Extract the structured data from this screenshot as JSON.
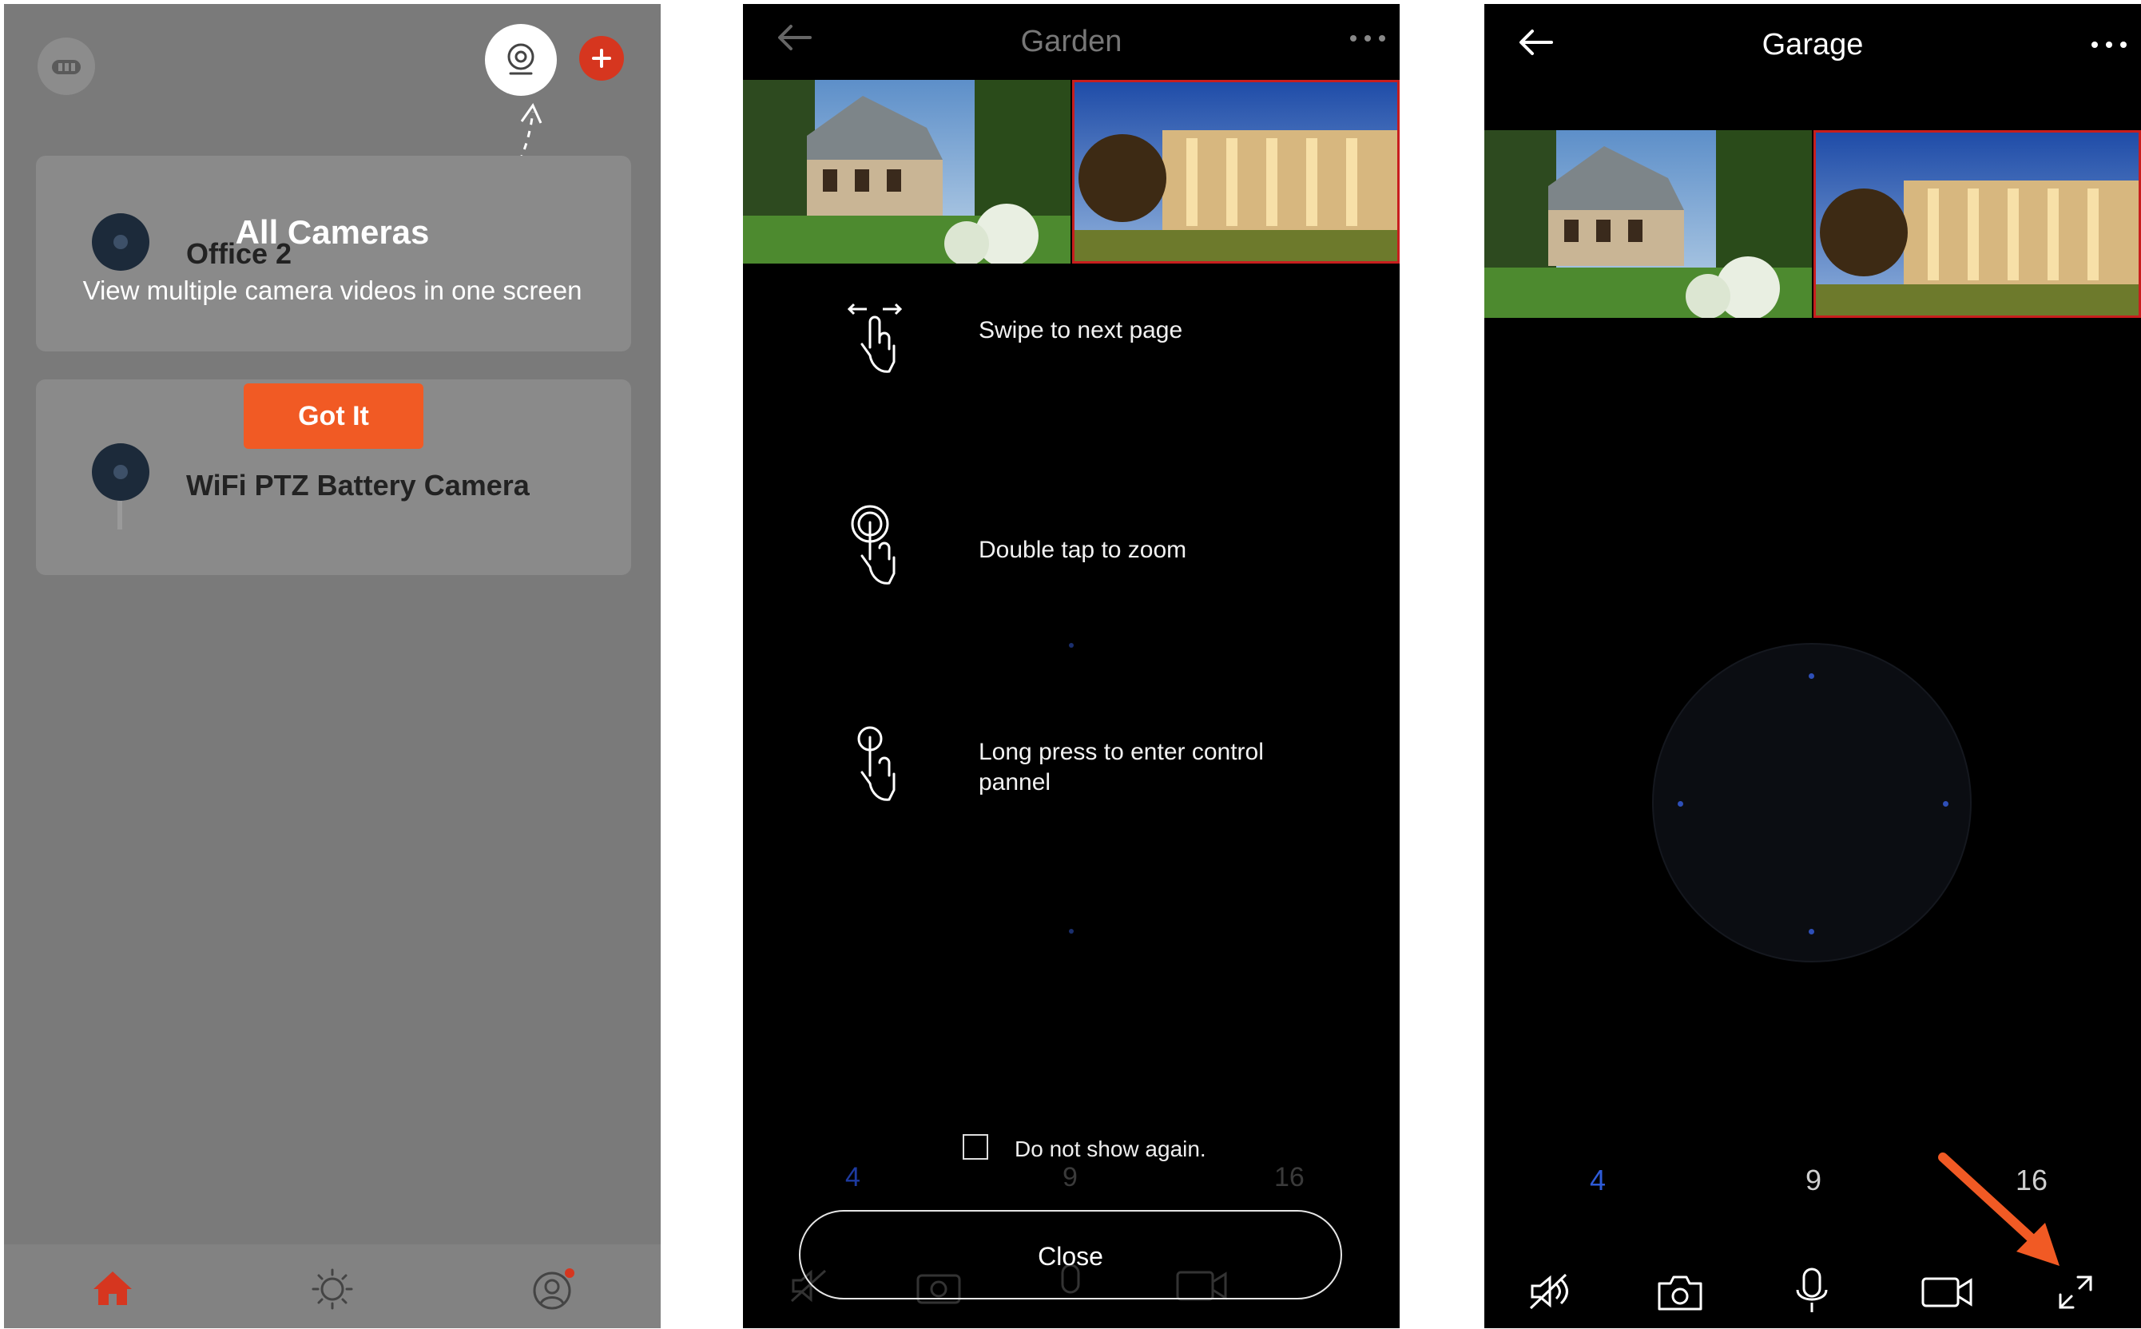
{
  "panel1": {
    "tooltip": {
      "title": "All Cameras",
      "subtitle": "View multiple camera videos in one screen"
    },
    "devices": [
      {
        "name": "Office 2"
      },
      {
        "name": "WiFi PTZ Battery Camera"
      }
    ],
    "got_it_label": "Got It",
    "colors": {
      "accent": "#f15a24",
      "overlay": "#7a7a7a",
      "brand_red": "#d6361f"
    },
    "icons": {
      "top_left": "cloud-icon",
      "all_cameras": "camera-view-icon",
      "add": "add-icon",
      "nav": [
        "home-icon",
        "light-icon",
        "profile-icon"
      ]
    }
  },
  "panel2": {
    "title": "Garden",
    "gestures": [
      {
        "icon": "swipe-gesture-icon",
        "label": "Swipe to next page"
      },
      {
        "icon": "double-tap-gesture-icon",
        "label": "Double tap to zoom"
      },
      {
        "icon": "long-press-gesture-icon",
        "label": "Long press to enter control pannel"
      }
    ],
    "dont_show_label": "Do not show again.",
    "close_label": "Close",
    "layout_options": [
      "4",
      "9",
      "16"
    ],
    "colors": {
      "selected": "#2a4cc7"
    }
  },
  "panel3": {
    "title": "Garage",
    "layout_options": [
      "4",
      "9",
      "16"
    ],
    "selected_layout": "4",
    "toolbar_icons": [
      "mute-icon",
      "snapshot-icon",
      "microphone-icon",
      "record-icon",
      "fullscreen-icon"
    ],
    "colors": {
      "selected": "#2e5bd8",
      "arrow": "#f15a24"
    }
  }
}
